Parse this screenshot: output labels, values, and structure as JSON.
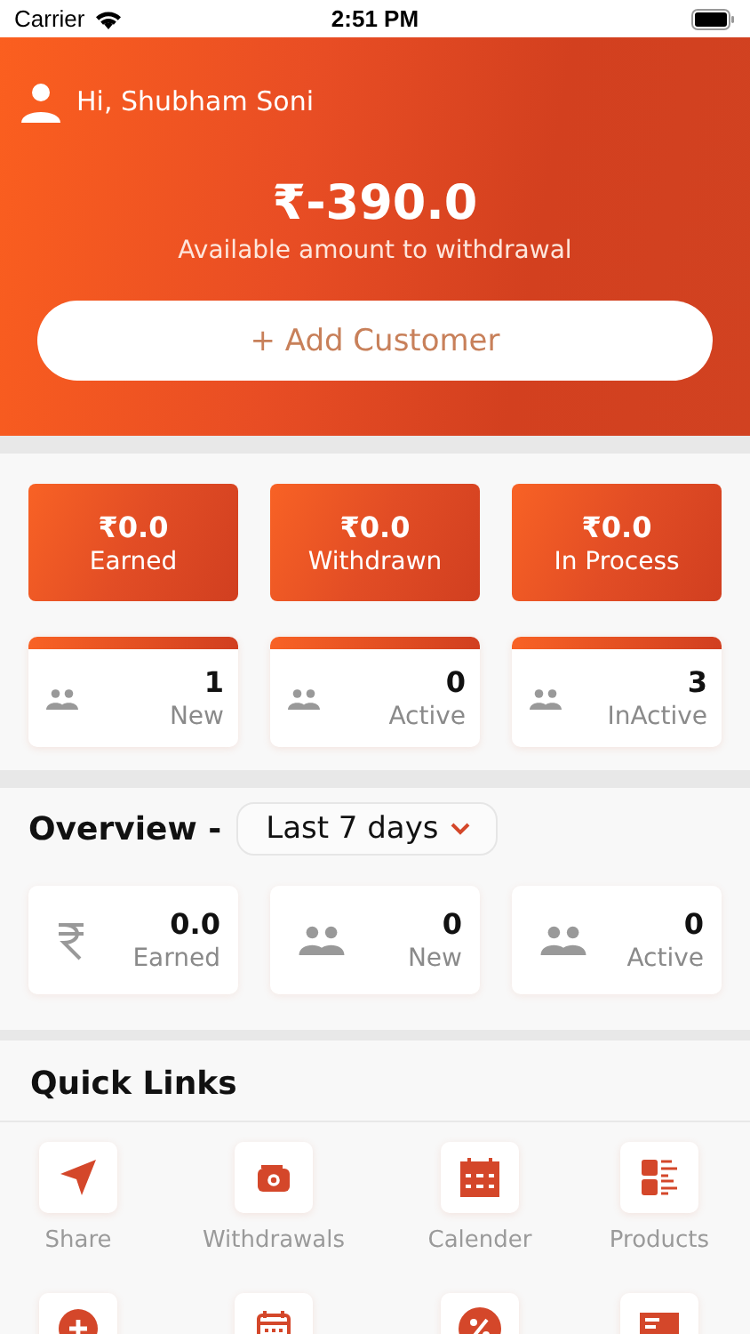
{
  "status_bar": {
    "carrier": "Carrier",
    "time": "2:51 PM"
  },
  "header": {
    "greeting": "Hi, Shubham Soni",
    "amount": "₹-390.0",
    "caption": "Available amount to withdrawal",
    "button": "+ Add Customer"
  },
  "totals": [
    {
      "amount": "₹0.0",
      "label": "Earned"
    },
    {
      "amount": "₹0.0",
      "label": "Withdrawn"
    },
    {
      "amount": "₹0.0",
      "label": "In Process"
    }
  ],
  "customers": [
    {
      "count": "1",
      "label": "New"
    },
    {
      "count": "0",
      "label": "Active"
    },
    {
      "count": "3",
      "label": "InActive"
    }
  ],
  "overview": {
    "title": "Overview -",
    "period": "Last 7 days",
    "cards": [
      {
        "kind": "money",
        "value": "0.0",
        "label": "Earned"
      },
      {
        "kind": "people",
        "value": "0",
        "label": "New"
      },
      {
        "kind": "people",
        "value": "0",
        "label": "Active"
      }
    ]
  },
  "quick_links": {
    "title": "Quick Links",
    "items": [
      {
        "kind": "share",
        "label": "Share"
      },
      {
        "kind": "wallet",
        "label": "Withdrawals"
      },
      {
        "kind": "calendar",
        "label": "Calender"
      },
      {
        "kind": "products",
        "label": "Products"
      },
      {
        "kind": "add"
      },
      {
        "kind": "calendar-outline"
      },
      {
        "kind": "percent"
      },
      {
        "kind": "card"
      }
    ]
  }
}
